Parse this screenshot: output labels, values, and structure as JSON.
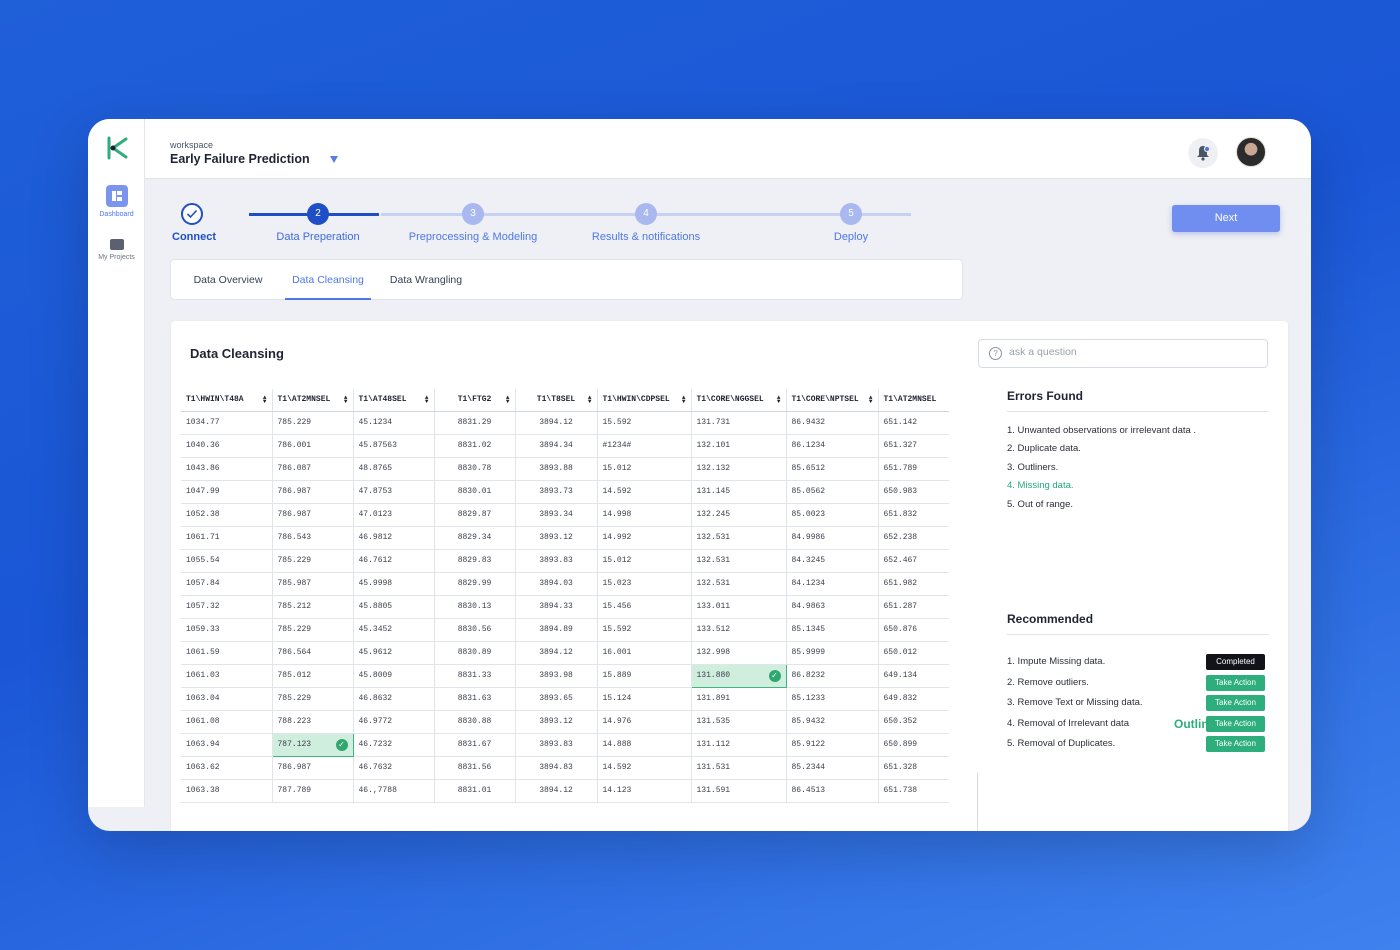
{
  "sidebar": {
    "items": [
      {
        "label": "Dashboard",
        "icon": "dashboard-icon"
      },
      {
        "label": "My Projects",
        "icon": "folder-icon"
      }
    ]
  },
  "workspace": {
    "label": "workspace",
    "title": "Early Failure Prediction"
  },
  "stepper": {
    "steps": [
      {
        "num": "",
        "label": "Connect",
        "state": "done"
      },
      {
        "num": "2",
        "label": "Data Preperation",
        "state": "current"
      },
      {
        "num": "3",
        "label": "Preprocessing & Modeling",
        "state": "todo"
      },
      {
        "num": "4",
        "label": "Results & notifications",
        "state": "todo"
      },
      {
        "num": "5",
        "label": "Deploy",
        "state": "todo"
      }
    ]
  },
  "next_label": "Next",
  "tabs": [
    {
      "label": "Data Overview",
      "active": false
    },
    {
      "label": "Data Cleansing",
      "active": true
    },
    {
      "label": "Data Wrangling",
      "active": false
    }
  ],
  "card": {
    "title": "Data Cleansing",
    "ask_placeholder": "ask a question",
    "question_mark": "?"
  },
  "table": {
    "columns": [
      "T1\\HWIN\\T48A",
      "T1\\AT2MNSEL",
      "T1\\AT48SEL",
      "T1\\FTG2",
      "T1\\T8SEL",
      "T1\\HWIN\\CDPSEL",
      "T1\\CORE\\NGGSEL",
      "T1\\CORE\\NPTSEL",
      "T1\\AT2MNSEL"
    ],
    "rows": [
      [
        "1034.77",
        "785.229",
        "45.1234",
        "8831.29",
        "3894.12",
        "15.592",
        "131.731",
        "86.9432",
        "651.142"
      ],
      [
        "1040.36",
        "786.001",
        "45.87563",
        "8831.02",
        "3894.34",
        "#1234#",
        "132.101",
        "86.1234",
        "651.327"
      ],
      [
        "1043.86",
        "786.087",
        "48.8765",
        "8830.78",
        "3893.88",
        "15.012",
        "132.132",
        "85.6512",
        "651.789"
      ],
      [
        "1047.99",
        "786.987",
        "47.8753",
        "8830.01",
        "3893.73",
        "14.592",
        "131.145",
        "85.0562",
        "650.983"
      ],
      [
        "1052.38",
        "786.987",
        "47.0123",
        "8829.87",
        "3893.34",
        "14.998",
        "132.245",
        "85.0023",
        "651.832"
      ],
      [
        "1061.71",
        "786.543",
        "46.9812",
        "8829.34",
        "3893.12",
        "14.992",
        "132.531",
        "84.9986",
        "652.238"
      ],
      [
        "1055.54",
        "785.229",
        "46.7612",
        "8829.83",
        "3893.83",
        "15.012",
        "132.531",
        "84.3245",
        "652.467"
      ],
      [
        "1057.84",
        "785.987",
        "45.9998",
        "8829.99",
        "3894.03",
        "15.023",
        "132.531",
        "84.1234",
        "651.982"
      ],
      [
        "1057.32",
        "785.212",
        "45.8805",
        "8830.13",
        "3894.33",
        "15.456",
        "133.011",
        "84.9863",
        "651.287"
      ],
      [
        "1059.33",
        "785.229",
        "45.3452",
        "8830.56",
        "3894.89",
        "15.592",
        "133.512",
        "85.1345",
        "650.876"
      ],
      [
        "1061.59",
        "786.564",
        "45.9612",
        "8830.89",
        "3894.12",
        "16.001",
        "132.998",
        "85.9999",
        "650.012"
      ],
      [
        "1061.03",
        "785.012",
        "45.8009",
        "8831.33",
        "3893.98",
        "15.889",
        "131.880",
        "86.8232",
        "649.134"
      ],
      [
        "1063.04",
        "785.229",
        "46.8632",
        "8831.63",
        "3893.65",
        "15.124",
        "131.891",
        "85.1233",
        "649.832"
      ],
      [
        "1061.08",
        "788.223",
        "46.9772",
        "8830.88",
        "3893.12",
        "14.976",
        "131.535",
        "85.9432",
        "650.352"
      ],
      [
        "1063.94",
        "787.123",
        "46.7232",
        "8831.67",
        "3893.83",
        "14.888",
        "131.112",
        "85.9122",
        "650.899"
      ],
      [
        "1063.62",
        "786.987",
        "46.7632",
        "8831.56",
        "3894.83",
        "14.592",
        "131.531",
        "85.2344",
        "651.328"
      ],
      [
        "1063.38",
        "787.789",
        "46.,7788",
        "8831.01",
        "3894.12",
        "14.123",
        "131.591",
        "86.4513",
        "651.738"
      ]
    ],
    "selected": [
      {
        "row": 11,
        "col": 6
      },
      {
        "row": 14,
        "col": 1
      }
    ]
  },
  "errors": {
    "title": "Errors Found",
    "items": [
      {
        "text": "1. Unwanted observations or irrelevant data .",
        "highlight": false
      },
      {
        "text": "2. Duplicate data.",
        "highlight": false
      },
      {
        "text": "3. Outliners.",
        "highlight": false
      },
      {
        "text": "4. Missing data.",
        "highlight": true
      },
      {
        "text": "5. Out of range.",
        "highlight": false
      }
    ]
  },
  "recommended": {
    "title": "Recommended",
    "overlay_text": "Outlin",
    "items": [
      {
        "text": "1. Impute Missing data.",
        "action": "Completed",
        "state": "done"
      },
      {
        "text": "2. Remove outliers.",
        "action": "Take Action",
        "state": "act"
      },
      {
        "text": "3. Remove Text or Missing data.",
        "action": "Take Action",
        "state": "act"
      },
      {
        "text": "4. Removal of Irrelevant data",
        "action": "Take Action",
        "state": "act"
      },
      {
        "text": "5. Removal of Duplicates.",
        "action": "Take Action",
        "state": "act"
      }
    ]
  },
  "colors": {
    "accent": "#4f78e6",
    "step_done": "#1f4fc4",
    "step_todo": "#a9b8ee",
    "success": "#2eae7c"
  }
}
